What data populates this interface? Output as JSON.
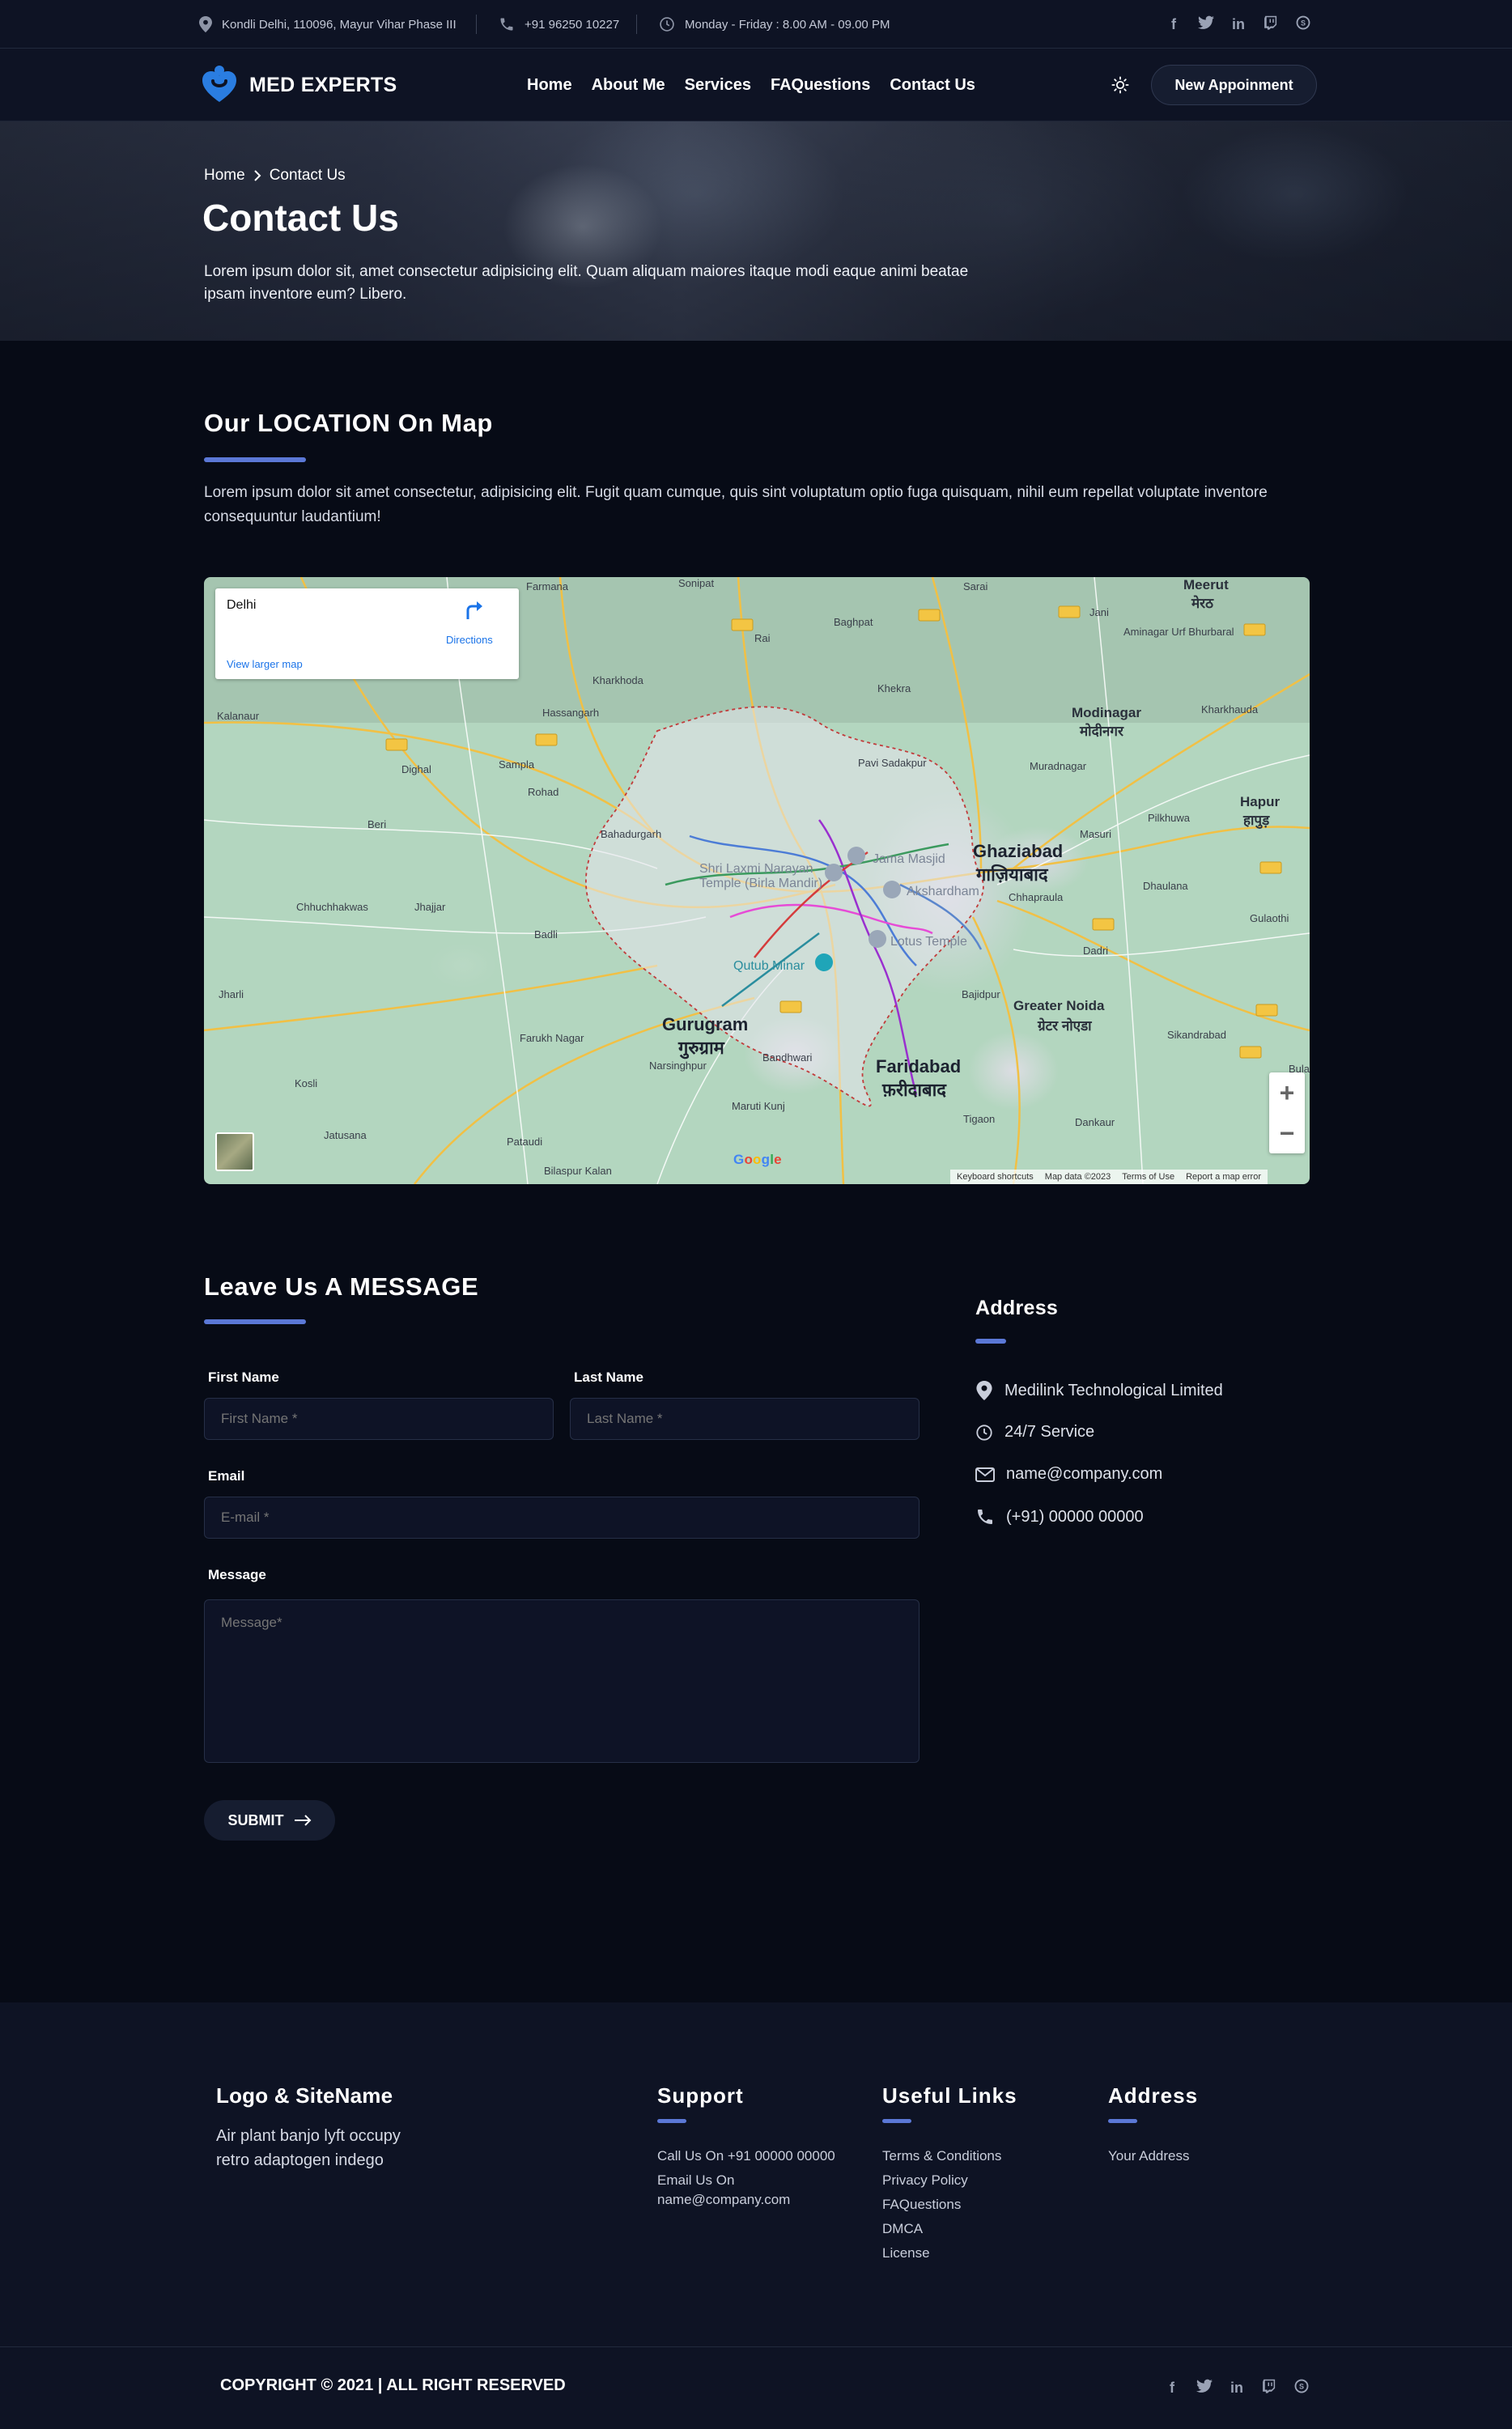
{
  "topbar": {
    "address": "Kondli Delhi, 110096, Mayur Vihar Phase III",
    "phone": "+91 96250 10227",
    "hours": "Monday - Friday : 8.00 AM - 09.00 PM",
    "social_icons": [
      "facebook-icon",
      "twitter-icon",
      "linkedin-icon",
      "twitch-icon",
      "skype-icon"
    ]
  },
  "nav": {
    "brand": "MED EXPERTS",
    "links": [
      "Home",
      "About Me",
      "Services",
      "FAQuestions",
      "Contact Us"
    ],
    "appointment": "New Appoinment"
  },
  "hero": {
    "breadcrumb_home": "Home",
    "breadcrumb_current": "Contact Us",
    "title": "Contact Us",
    "text": "Lorem ipsum dolor sit, amet consectetur adipisicing elit. Quam aliquam maiores itaque modi eaque animi beatae ipsam inventore eum? Libero."
  },
  "location": {
    "title": "Our LOCATION On Map",
    "text": "Lorem ipsum dolor sit amet consectetur, adipisicing elit. Fugit quam cumque, quis sint voluptatum optio fuga quisquam, nihil eum repellat voluptate inventore consequuntur laudantium!"
  },
  "map": {
    "card_city": "Delhi",
    "directions": "Directions",
    "larger_map": "View larger map",
    "labels": {
      "ghaziabad": "Ghaziabad",
      "ghaziabad_hi": "गाज़ियाबाद",
      "gurugram": "Gurugram",
      "gurugram_hi": "गुरुग्राम",
      "faridabad": "Faridabad",
      "faridabad_hi": "फ़रीदाबाद",
      "greater_noida": "Greater Noida",
      "greater_noida_hi": "ग्रेटर नोएडा",
      "meerut": "Meerut",
      "meerut_hi": "मेरठ",
      "modinagar": "Modinagar",
      "modinagar_hi": "मोदीनगर",
      "hapur": "Hapur",
      "hapur_hi": "हापुड़",
      "baghpat": "Baghpat",
      "khekra": "Khekra",
      "rai": "Rai",
      "farmana": "Farmana",
      "sonipat": "Sonipat",
      "kharkhoda": "Kharkhoda",
      "hassangarh": "Hassangarh",
      "kalanaur": "Kalanaur",
      "sampla": "Sampla",
      "rohad": "Rohad",
      "dighal": "Dighal",
      "beri": "Beri",
      "bahadurgarh": "Bahadurgarh",
      "chhuchhakwas": "Chhuchhakwas",
      "jhajjar": "Jhajjar",
      "badli": "Badli",
      "jharli": "Jharli",
      "farukh_nagar": "Farukh Nagar",
      "narsinghpur": "Narsinghpur",
      "kosli": "Kosli",
      "jatusana": "Jatusana",
      "pataudi": "Pataudi",
      "bilaspur_kalan": "Bilaspur Kalan",
      "maruti_kunj": "Maruti Kunj",
      "bandhwari": "Bandhwari",
      "tigaon": "Tigaon",
      "dankaur": "Dankaur",
      "bajidpur": "Bajidpur",
      "dadri": "Dadri",
      "chhaprauli": "Chhapraula",
      "masuri": "Masuri",
      "muradnagar": "Muradnagar",
      "pilkhuwa": "Pilkhuwa",
      "dhaulana": "Dhaulana",
      "gulaothi": "Gulaothi",
      "sikandrabad": "Sikandrabad",
      "pavi_sadakpur": "Pavi Sadakpur",
      "kharkhauda_e": "Kharkhauda",
      "sarai": "Sarai",
      "aminagar": "Aminagar Urf Bhurbaral",
      "jani": "Jani",
      "jama_masjid": "Jama Masjid",
      "birla_mandir": "Shri Laxmi Narayan Temple (Birla Mandir)",
      "akshardham": "Akshardham",
      "lotus_temple": "Lotus Temple",
      "qutub_minar": "Qutub Minar",
      "bulan": "Bulan"
    },
    "footer_items": [
      "Keyboard shortcuts",
      "Map data ©2023",
      "Terms of Use",
      "Report a map error"
    ],
    "google": "Google"
  },
  "contact_form": {
    "title": "Leave Us A MESSAGE",
    "first_name_label": "First Name",
    "first_name_placeholder": "First Name *",
    "last_name_label": "Last Name",
    "last_name_placeholder": "Last Name *",
    "email_label": "Email",
    "email_placeholder": "E-mail *",
    "message_label": "Message",
    "message_placeholder": "Message*",
    "submit": "SUBMIT"
  },
  "address": {
    "title": "Address",
    "company": "Medilink Technological Limited",
    "service": "24/7 Service",
    "email": "name@company.com",
    "phone": "(+91) 00000 00000"
  },
  "footer": {
    "logo_title": "Logo & SiteName",
    "logo_text": "Air plant banjo lyft occupy retro adaptogen indego",
    "support_title": "Support",
    "support_call": "Call Us On +91 00000 00000",
    "support_email_label": "Email Us On",
    "support_email": "name@company.com",
    "links_title": "Useful Links",
    "links": [
      "Terms & Conditions",
      "Privacy Policy",
      "FAQuestions",
      "DMCA",
      "License"
    ],
    "address_title": "Address",
    "address_text": "Your Address",
    "copyright": "COPYRIGHT © 2021  |  ALL RIGHT RESERVED"
  },
  "colors": {
    "background": "#070b16",
    "header": "#0e1324",
    "accent": "#5b78d6",
    "brand_icon": "#2a7de1"
  }
}
